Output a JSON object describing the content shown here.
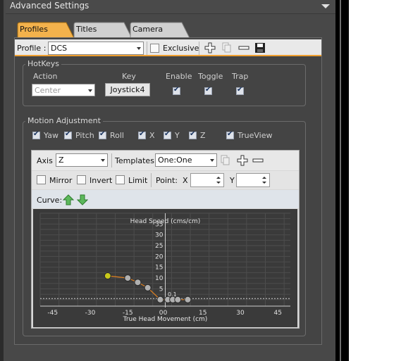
{
  "window": {
    "title": "Advanced Settings"
  },
  "tabs": [
    {
      "label": "Profiles",
      "active": true
    },
    {
      "label": "Titles",
      "active": false
    },
    {
      "label": "Camera",
      "active": false
    }
  ],
  "profile_bar": {
    "profile_label": "Profile :",
    "profile_value": "DCS",
    "exclusive_label": "Exclusive",
    "exclusive_checked": false
  },
  "hotkeys": {
    "group_title": "HotKeys",
    "col_action": "Action",
    "col_key": "Key",
    "col_enable": "Enable",
    "col_toggle": "Toggle",
    "col_trap": "Trap",
    "action_value": "Center",
    "key_button": "Joystick4",
    "enable": true,
    "toggle": true,
    "trap": true
  },
  "motion": {
    "group_title": "Motion Adjustment",
    "axes": [
      {
        "label": "Yaw",
        "checked": true
      },
      {
        "label": "Pitch",
        "checked": true
      },
      {
        "label": "Roll",
        "checked": true
      },
      {
        "label": "X",
        "checked": true
      },
      {
        "label": "Y",
        "checked": true
      },
      {
        "label": "Z",
        "checked": true
      },
      {
        "label": "TrueView",
        "checked": true
      }
    ]
  },
  "curve_editor": {
    "axis_label": "Axis",
    "axis_value": "Z",
    "templates_label": "Templates",
    "templates_value": "One:One",
    "mirror_label": "Mirror",
    "invert_label": "Invert",
    "limit_label": "Limit",
    "point_label": "Point:",
    "x_label": "X",
    "y_label": "Y",
    "x_value": "",
    "y_value": "",
    "curve_label": "Curve:"
  },
  "chart_data": {
    "type": "line",
    "title": "",
    "xlabel": "True Head Movement (cm)",
    "ylabel": "Head Speed (cms/cm)",
    "xlim": [
      -50,
      50
    ],
    "ylim": [
      -3,
      40
    ],
    "xticks": [
      -45,
      -30,
      -15,
      0,
      15,
      30,
      45
    ],
    "yticks": [
      5,
      10,
      15,
      20,
      25,
      30,
      35
    ],
    "extra_tick_label": "0.1",
    "grid": true,
    "series": [
      {
        "points": [
          {
            "x": -23,
            "y": 11,
            "selected": true
          },
          {
            "x": -15,
            "y": 10,
            "selected": false
          },
          {
            "x": -11,
            "y": 8,
            "selected": false
          },
          {
            "x": -7,
            "y": 5.5,
            "selected": false
          },
          {
            "x": -2,
            "y": 0,
            "selected": false
          },
          {
            "x": 1,
            "y": 0,
            "selected": false
          },
          {
            "x": 3,
            "y": 0,
            "selected": false
          },
          {
            "x": 5,
            "y": 0,
            "selected": false
          },
          {
            "x": 9,
            "y": 0,
            "selected": false
          }
        ],
        "color": "#e08020"
      }
    ],
    "reference_line_y": 0.5
  },
  "colors": {
    "accent": "#f0a030",
    "selected_point": "#c8c81a",
    "point": "#b0b0b0",
    "curve": "#e08020"
  }
}
